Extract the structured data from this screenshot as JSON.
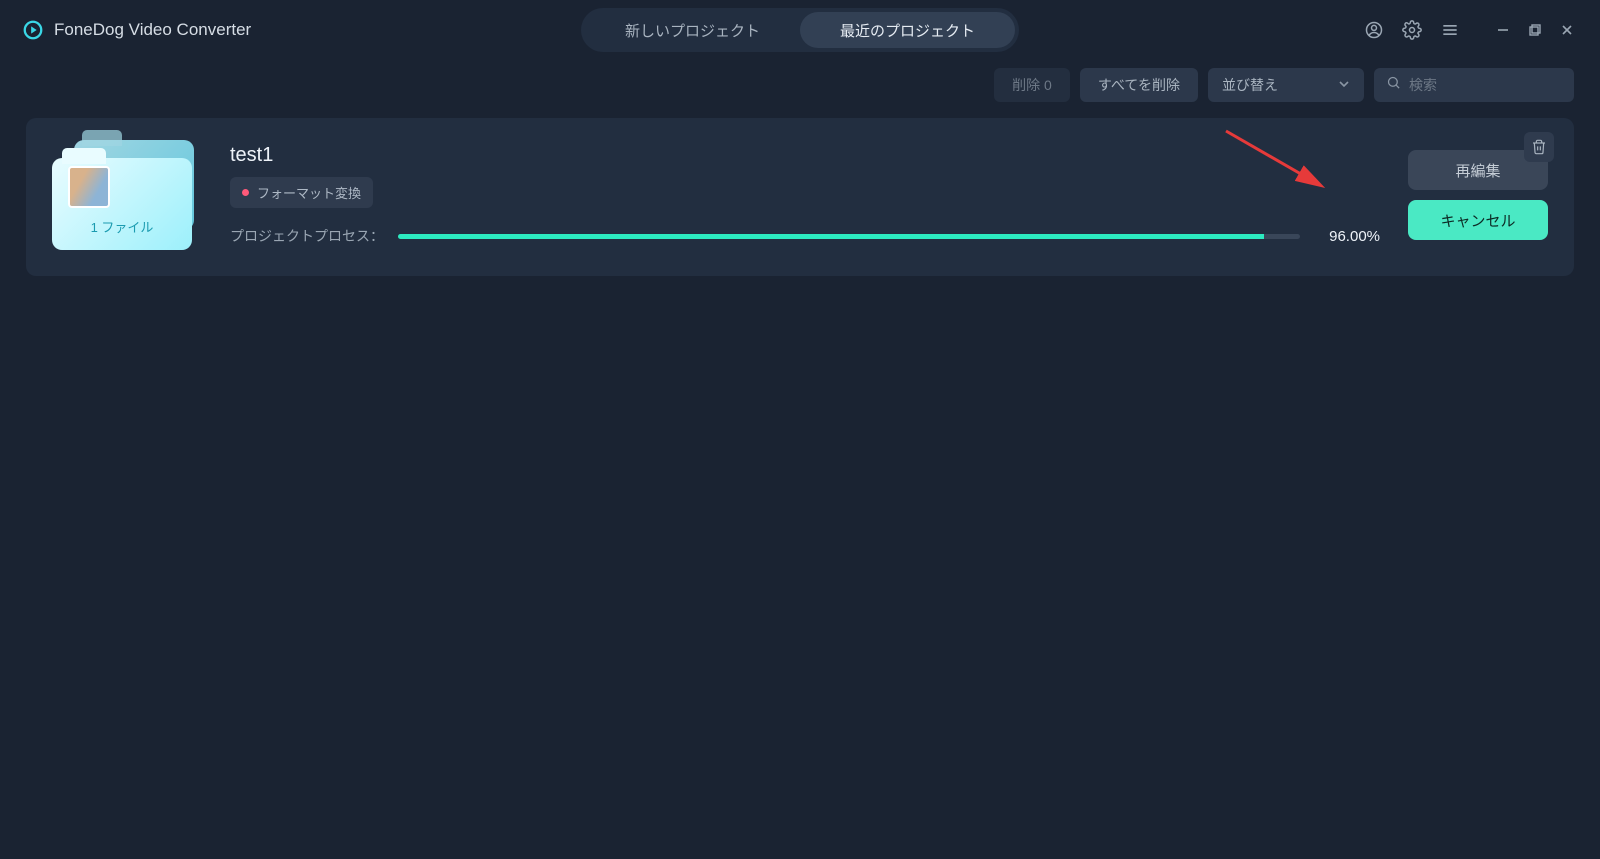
{
  "app": {
    "title": "FoneDog Video Converter"
  },
  "header": {
    "tab_new": "新しいプロジェクト",
    "tab_recent": "最近のプロジェクト"
  },
  "toolbar": {
    "delete_count": "削除 0",
    "delete_all": "すべてを削除",
    "sort_label": "並び替え",
    "search_placeholder": "検索"
  },
  "project": {
    "title": "test1",
    "badge": "フォーマット変換",
    "folder_label": "1 ファイル",
    "process_label": "プロジェクトプロセス：",
    "progress_pct_text": "96.00%",
    "progress_pct": 96,
    "reedit": "再編集",
    "cancel": "キャンセル"
  }
}
